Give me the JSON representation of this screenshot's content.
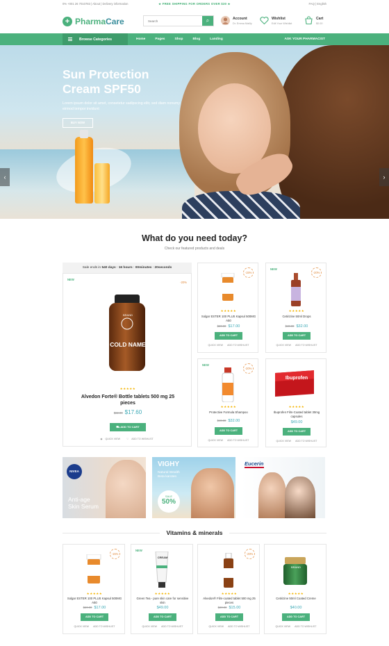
{
  "topbar": {
    "left": "0% +001 26 7010783   |   About   |   Delivery information",
    "center": "FREE SHIPPING FOR ORDERS OVER $30",
    "right": "FAQ   |   English"
  },
  "logo": {
    "mark": "+",
    "text_a": "Pharma",
    "text_b": "Care"
  },
  "search": {
    "placeholder": "Search"
  },
  "account": {
    "title": "Account",
    "sub": "Dr. Emma Mailly"
  },
  "wishlist": {
    "title": "Wishlist",
    "sub": "Edit Your Wishlist"
  },
  "cart": {
    "title": "Cart",
    "sub": "$0.00"
  },
  "nav": {
    "browse": "Browse Categories",
    "links": [
      "Home",
      "Pages",
      "Shop",
      "Blog",
      "Landing"
    ],
    "right": "ASK YOUR PHARMACIST"
  },
  "hero": {
    "title_line1": "Sun Protection",
    "title_line2": "Cream SPF50",
    "text": "Lorem ipsum dolor sit amet, consetetur sadipscing elitr, sed diam nonumy eirmod tempor invidunt",
    "button": "BUY NOW",
    "prev": "‹",
    "next": "›"
  },
  "featured": {
    "title": "What do you need today?",
    "subtitle": "Check our featured products and deals",
    "timer": {
      "label": "Sale ends in",
      "days": "540 days",
      "hours": "16 hours",
      "minutes": "00minutes",
      "seconds": "20seconds"
    },
    "big": {
      "badge_new": "NEW",
      "badge_off": "-20%",
      "jar_brand": "BRAND",
      "jar_label": "COLD NAME",
      "stars": "★★★★★",
      "name": "Alvedon Forte® Bottle tablets 500 mg 25 pieces",
      "old_price": "$22.00",
      "price": "$17.60",
      "cart": "ADD TO CART",
      "quick": "QUICK VIEW",
      "wish": "ADD TO WISHLIST"
    },
    "small": [
      {
        "badge_new": "",
        "badge_off": "-15%",
        "name": "Solgar ESTER 100 PLUS Kapsul 500MG A50",
        "old_price": "$20.00",
        "price": "$17.00"
      },
      {
        "badge_new": "NEW",
        "badge_off": "-20%",
        "name": "Cetirizine 50ml Drops",
        "old_price": "$40.00",
        "price": "$32.00"
      },
      {
        "badge_new": "NEW",
        "badge_off": "-20%",
        "name": "Protective Formula Shampoo",
        "old_price": "$40.00",
        "price": "$32.00"
      },
      {
        "badge_new": "",
        "badge_off": "",
        "name": "Ibuprofen Film-Coated tablet 30mg capsules",
        "old_price": "",
        "price": "$49.00"
      }
    ],
    "cart": "ADD TO CART",
    "quick": "QUICK VIEW",
    "wish": "ADD TO WISHLIST",
    "stars": "★★★★★",
    "ibuprofen_label": "Ibuprofen"
  },
  "banners": [
    {
      "brand": "NIVEA",
      "line1": "Anti-age",
      "line2": "Skin Serum"
    },
    {
      "brand": "VIGHY",
      "line1": "Natural Wealth",
      "line2": "Beta karoten",
      "sale": "SALE",
      "percent": "50%"
    },
    {
      "brand": "Eucerin"
    }
  ],
  "vitamins": {
    "title": "Vitamins & minerals",
    "items": [
      {
        "badge_new": "",
        "badge_off": "-15%",
        "name": "Solgar ESTER 100 PLUS Kapsul 500MG A50",
        "old_price": "$20.00",
        "price": "$17.00",
        "label": ""
      },
      {
        "badge_new": "NEW",
        "badge_off": "",
        "name": "Green Tea - pure skin care for sensitive skin",
        "old_price": "",
        "price": "$49.00",
        "label": "CREAM"
      },
      {
        "badge_new": "",
        "badge_off": "-29%",
        "name": "Alvedon® Film-coated tablet 500 mg 25 pieces",
        "old_price": "$20.00",
        "price": "$15.00",
        "label": ""
      },
      {
        "badge_new": "",
        "badge_off": "",
        "name": "Cetirizine 50ml Coated Creme",
        "old_price": "",
        "price": "$40.00",
        "label": "BRAND"
      }
    ]
  },
  "colors": {
    "green": "#4bb17d",
    "dark_green": "#3e9c6b",
    "price_teal": "#3aa8b5",
    "star": "#f4b400",
    "discount": "#e08a3c"
  }
}
